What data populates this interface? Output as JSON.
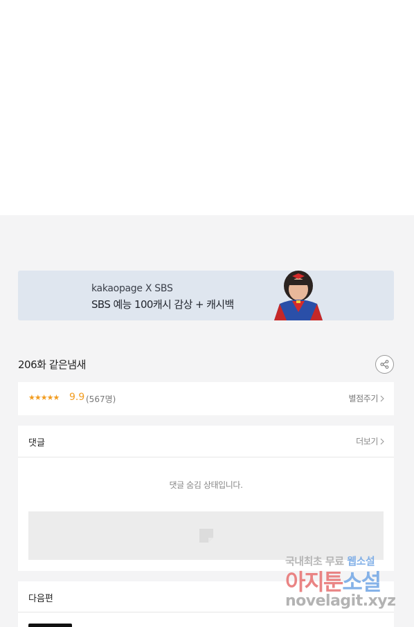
{
  "banner": {
    "sub_text": "kakaopage X SBS",
    "main_text": "SBS 예능 100캐시 감상 + 캐시백"
  },
  "episode": {
    "title": "206화 같은냄새"
  },
  "rating": {
    "stars": "★★★★★",
    "score": "9.9",
    "count": "(567명)",
    "rate_link": "별점주기"
  },
  "comments": {
    "label": "댓글",
    "more_link": "더보기",
    "hidden_message": "댓글 숨김 상태입니다."
  },
  "next": {
    "label": "다음편"
  },
  "watermark": {
    "line1_a": "국내최초 무료",
    "line1_b": "웹소설",
    "line2_a": "아지툰",
    "line2_b": "소설",
    "line3": "novelagit.xyz"
  },
  "colors": {
    "accent_orange": "#f29c1f",
    "banner_bg": "#dfe6ef",
    "page_bg": "#f4f4f5"
  }
}
